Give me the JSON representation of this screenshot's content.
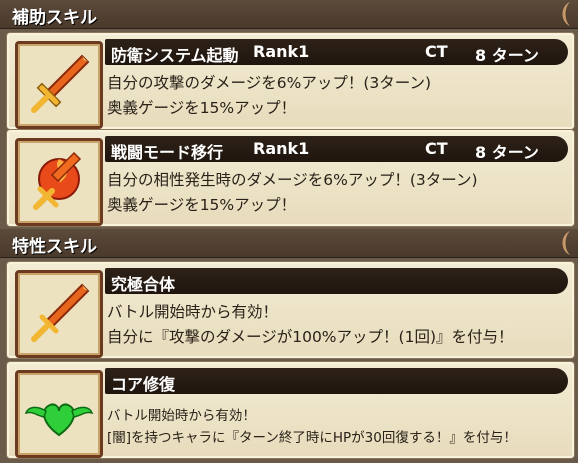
{
  "support_section": {
    "title": "補助スキル"
  },
  "trait_section": {
    "title": "特性スキル"
  },
  "skills": [
    {
      "name": "防衛システム起動",
      "rank": "Rank1",
      "ct_label": "CT",
      "ct_value": "8 ターン",
      "lines": [
        "自分の攻撃のダメージを6%アップ！(3ターン)",
        "奥義ゲージを15%アップ！"
      ],
      "icon": "sword-icon"
    },
    {
      "name": "戦闘モード移行",
      "rank": "Rank1",
      "ct_label": "CT",
      "ct_value": "8 ターン",
      "lines": [
        "自分の相性発生時のダメージを6%アップ！(3ターン)",
        "奥義ゲージを15%アップ！"
      ],
      "icon": "flame-sword-icon"
    },
    {
      "name": "究極合体",
      "lines": [
        "バトル開始時から有効！",
        "自分に『攻撃のダメージが100%アップ！(1回)』を付与！"
      ],
      "icon": "sword-icon"
    },
    {
      "name": "コア修復",
      "lines": [
        "バトル開始時から有効！",
        "[闇]を持つキャラに『ターン終了時にHPが30回復する！』を付与！"
      ],
      "icon": "winged-heart-icon"
    }
  ],
  "colors": {
    "header_bg": "#4a3a2c",
    "card_bg": "#f3ecd4",
    "name_bar": "#1e150e",
    "heart_green": "#2fcf3a",
    "sword_orange": "#e8651e"
  }
}
